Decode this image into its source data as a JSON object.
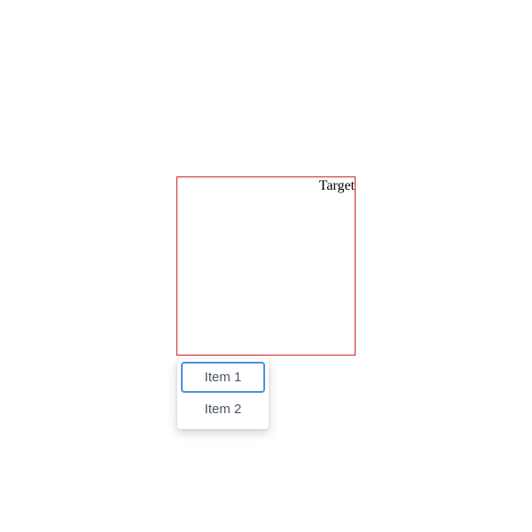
{
  "target": {
    "label": "Target",
    "border_color": "#c8232c"
  },
  "menu": {
    "items": [
      {
        "label": "Item 1",
        "focused": true
      },
      {
        "label": "Item 2",
        "focused": false
      }
    ],
    "focus_color": "#4a90e2"
  }
}
